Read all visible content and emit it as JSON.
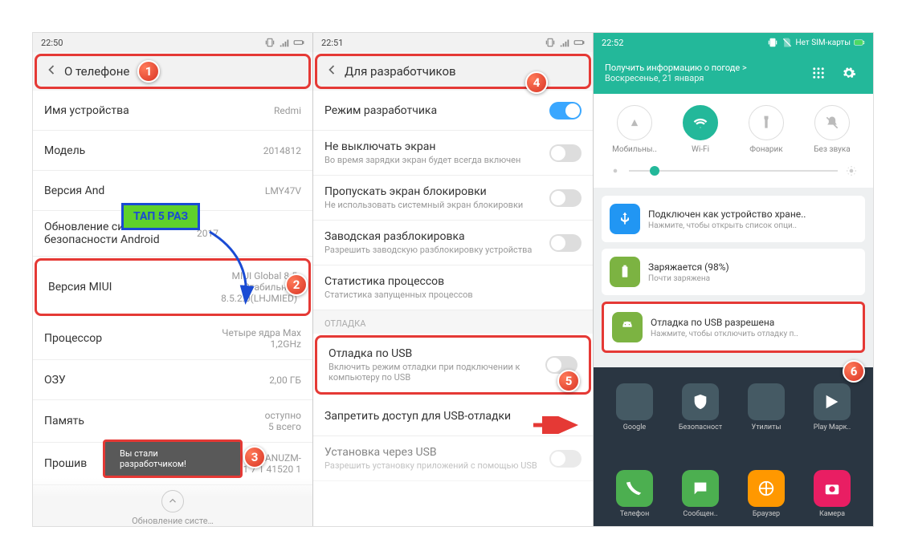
{
  "phone1": {
    "time": "22:50",
    "header_title": "О телефоне",
    "rows": {
      "device_name": {
        "label": "Имя устройства",
        "value": "Redmi"
      },
      "model": {
        "label": "Модель",
        "value": "2014812"
      },
      "android_ver": {
        "label": "Версия And",
        "value": "LMY47V"
      },
      "security": {
        "label": "Обновление системы безопасности Android",
        "value": "2017"
      },
      "miui": {
        "label": "Версия MIUI",
        "value1": "MIUI Global 8.5",
        "value2": "Стабильная",
        "value3": "8.5.2.0(LHJMIED)"
      },
      "cpu": {
        "label": "Процессор",
        "value1": "Четыре ядра Max",
        "value2": "1,2GHz"
      },
      "ram": {
        "label": "ОЗУ",
        "value": "2,00 ГБ"
      },
      "storage": {
        "label": "Память",
        "value1": "оступно",
        "value2": "5 всего"
      },
      "firmware": {
        "label": "Прошив",
        "value1": "AANUZM-",
        "value2": "1 7 1 41520 1"
      }
    },
    "callout": "ТАП 5 РАЗ",
    "toast": "Вы стали разработчиком!",
    "update_label": "Обновление систе…"
  },
  "phone2": {
    "time": "22:51",
    "header_title": "Для разработчиков",
    "rows": {
      "dev_mode": {
        "label": "Режим разработчика"
      },
      "stay_awake": {
        "label": "Не выключать экран",
        "sub": "Во время зарядки экран будет всегда включен"
      },
      "skip_lock": {
        "label": "Пропускать экран блокировки",
        "sub": "Не использовать системный экран блокировки"
      },
      "oem": {
        "label": "Заводская разблокировка",
        "sub": "Разрешить заводскую разблокировку устройства"
      },
      "stats": {
        "label": "Статистика процессов",
        "sub": "Статистика запущенных процессов"
      },
      "section_debug": "ОТЛАДКА",
      "usb_debug": {
        "label": "Отладка по USB",
        "sub": "Включить режим отладки при подключении к компьютеру по USB"
      },
      "revoke": {
        "label": "Запретить доступ для USB-отладки"
      },
      "install": {
        "label": "Установка через USB",
        "sub": "Разрешить установку приложений с помощью USB"
      }
    }
  },
  "phone3": {
    "time": "22:52",
    "sim_label": "Нет SIM-карты",
    "weather_line1": "Получить информацию о погоде >",
    "weather_line2": "Воскресенье, 21 января",
    "tiles": {
      "mobile": "Мобильны..",
      "wifi": "Wi-Fi",
      "flash": "Фонарик",
      "silent": "Без звука"
    },
    "notifs": {
      "usb_storage": {
        "title": "Подключен как устройство хране..",
        "sub": "Нажмите, чтобы открыть список опци.."
      },
      "charging": {
        "title": "Заряжается (98%)",
        "sub": "Почти заряжена"
      },
      "usb_debug": {
        "title": "Отладка по USB разрешена",
        "sub": "Нажмите, чтобы отключить отладку п.."
      }
    },
    "apps_top": {
      "google": "Google",
      "security": "Безопасност",
      "tools": "Утилиты",
      "play": "Play Марк.."
    },
    "apps_bottom": {
      "phone": "Телефон",
      "sms": "Сообщен..",
      "browser": "Браузер",
      "camera": "Камера"
    }
  },
  "badges": {
    "b1": "1",
    "b2": "2",
    "b3": "3",
    "b4": "4",
    "b5": "5",
    "b6": "6"
  }
}
